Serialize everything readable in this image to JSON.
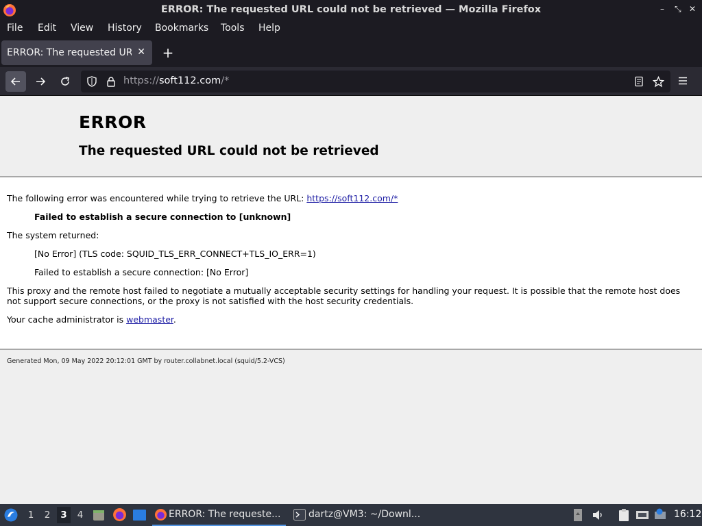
{
  "window": {
    "title": "ERROR: The requested URL could not be retrieved — Mozilla Firefox",
    "controls": [
      "–",
      "⤡",
      "✕"
    ]
  },
  "menubar": {
    "items": [
      "File",
      "Edit",
      "View",
      "History",
      "Bookmarks",
      "Tools",
      "Help"
    ]
  },
  "tabs": [
    {
      "label": "ERROR: The requested URL could not be retrieved",
      "active": true
    }
  ],
  "newtab_label": "+",
  "navbar": {
    "url_proto": "https://",
    "url_host": "soft112.com",
    "url_rest": "/*"
  },
  "page": {
    "h1": "ERROR",
    "h2": "The requested URL could not be retrieved",
    "intro": "The following error was encountered while trying to retrieve the URL: ",
    "intro_link": "https://soft112.com/*",
    "error_line": "Failed to establish a secure connection to [unknown]",
    "system_returned": "The system returned:",
    "sys_line1": "[No Error] (TLS code: SQUID_TLS_ERR_CONNECT+TLS_IO_ERR=1)",
    "sys_line2": "Failed to establish a secure connection: [No Error]",
    "explanation": "This proxy and the remote host failed to negotiate a mutually acceptable security settings for handling your request. It is possible that the remote host does not support secure connections, or the proxy is not satisfied with the host security credentials.",
    "admin_prefix": "Your cache administrator is ",
    "admin_link": "webmaster",
    "admin_suffix": ".",
    "footer": "Generated Mon, 09 May 2022 20:12:01 GMT by router.collabnet.local (squid/5.2-VCS)"
  },
  "taskbar": {
    "workspaces": [
      "1",
      "2",
      "3",
      "4"
    ],
    "active_workspace": "3",
    "apps": [
      {
        "label": "ERROR: The requeste...",
        "icon": "firefox-icon",
        "active": true
      },
      {
        "label": "dartz@VM3: ~/Downl...",
        "icon": "terminal-icon",
        "active": false
      }
    ],
    "clock": "16:12"
  },
  "colors": {
    "chrome_dark": "#1c1b22",
    "navbar": "#2b2a33",
    "link": "#1f1fa5",
    "taskbar": "#2f343f",
    "taskbar_accent": "#5294e2"
  }
}
